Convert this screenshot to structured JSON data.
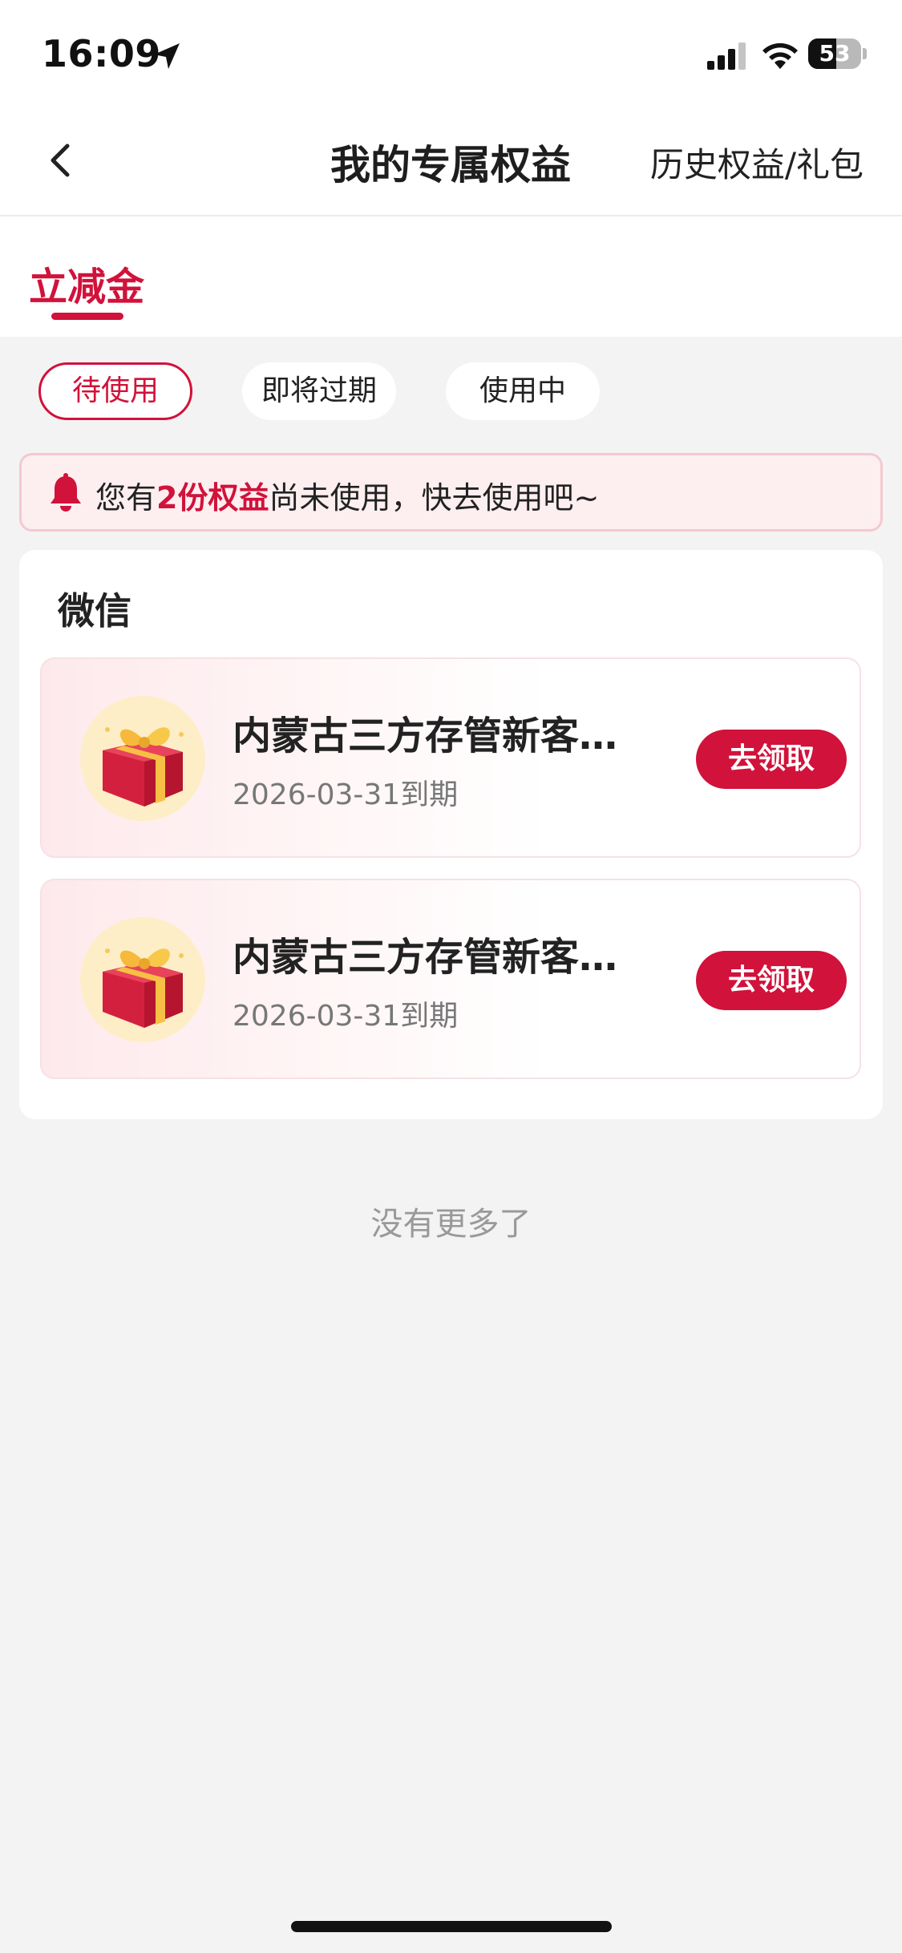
{
  "status_bar": {
    "time": "16:09",
    "battery": "53",
    "battery_level": 0.53
  },
  "nav": {
    "title": "我的专属权益",
    "history_link": "历史权益/礼包"
  },
  "category_tabs": [
    {
      "label": "立减金",
      "active": true
    }
  ],
  "filters": [
    {
      "label": "待使用",
      "active": true
    },
    {
      "label": "即将过期",
      "active": false
    },
    {
      "label": "使用中",
      "active": false
    }
  ],
  "notice": {
    "prefix": "您有",
    "highlight": "2份权益",
    "suffix": "尚未使用，快去使用吧~"
  },
  "section": {
    "title": "微信",
    "items": [
      {
        "name": "内蒙古三方存管新客…",
        "expiry": "2026-03-31到期",
        "button": "去领取"
      },
      {
        "name": "内蒙古三方存管新客…",
        "expiry": "2026-03-31到期",
        "button": "去领取"
      }
    ]
  },
  "footer": {
    "no_more": "没有更多了"
  },
  "colors": {
    "accent": "#d1123a",
    "background": "#f3f3f3",
    "notice_bg": "#fdeef0"
  },
  "icons": {
    "back": "chevron-left-icon",
    "bell": "bell-icon",
    "gift": "gift-icon",
    "location": "location-arrow-icon",
    "signal": "cellular-signal-icon",
    "wifi": "wifi-icon"
  }
}
